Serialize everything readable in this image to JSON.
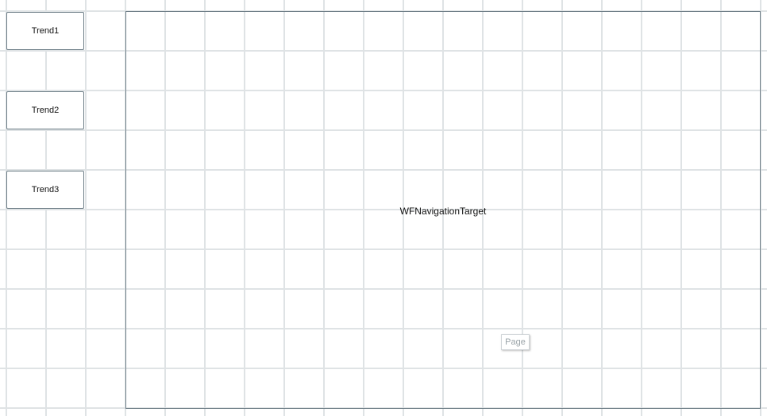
{
  "buttons": [
    {
      "label": "Trend1"
    },
    {
      "label": "Trend2"
    },
    {
      "label": "Trend3"
    }
  ],
  "navigation_target": {
    "label": "WFNavigationTarget",
    "page_chip": "Page"
  },
  "colors": {
    "grid_line": "#dfe3e5",
    "border": "#6f7f88",
    "chip_text": "#9aa3a8"
  }
}
